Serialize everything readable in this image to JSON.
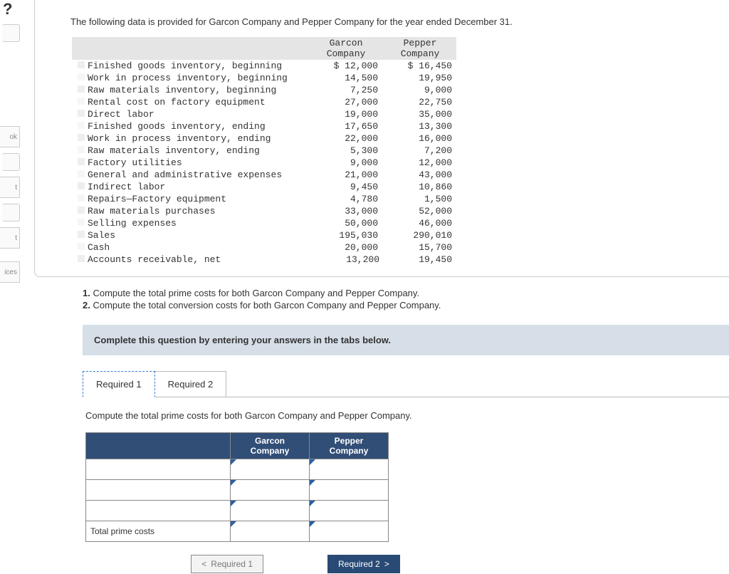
{
  "intro": "The following data is provided for Garcon Company and Pepper Company for the year ended December 31.",
  "table": {
    "headers": {
      "col1": "Garcon\nCompany",
      "col2": "Pepper\nCompany"
    },
    "rows": [
      {
        "label": "Finished goods inventory, beginning",
        "garcon": "$ 12,000",
        "pepper": "$ 16,450"
      },
      {
        "label": "Work in process inventory, beginning",
        "garcon": "14,500",
        "pepper": "19,950"
      },
      {
        "label": "Raw materials inventory, beginning",
        "garcon": "7,250",
        "pepper": "9,000"
      },
      {
        "label": "Rental cost on factory equipment",
        "garcon": "27,000",
        "pepper": "22,750"
      },
      {
        "label": "Direct labor",
        "garcon": "19,000",
        "pepper": "35,000"
      },
      {
        "label": "Finished goods inventory, ending",
        "garcon": "17,650",
        "pepper": "13,300"
      },
      {
        "label": "Work in process inventory, ending",
        "garcon": "22,000",
        "pepper": "16,000"
      },
      {
        "label": "Raw materials inventory, ending",
        "garcon": "5,300",
        "pepper": "7,200"
      },
      {
        "label": "Factory utilities",
        "garcon": "9,000",
        "pepper": "12,000"
      },
      {
        "label": "General and administrative expenses",
        "garcon": "21,000",
        "pepper": "43,000"
      },
      {
        "label": "Indirect labor",
        "garcon": "9,450",
        "pepper": "10,860"
      },
      {
        "label": "Repairs—Factory equipment",
        "garcon": "4,780",
        "pepper": "1,500"
      },
      {
        "label": "Raw materials purchases",
        "garcon": "33,000",
        "pepper": "52,000"
      },
      {
        "label": "Selling expenses",
        "garcon": "50,000",
        "pepper": "46,000"
      },
      {
        "label": "Sales",
        "garcon": "195,030",
        "pepper": "290,010"
      },
      {
        "label": "Cash",
        "garcon": "20,000",
        "pepper": "15,700"
      },
      {
        "label": "Accounts receivable, net",
        "garcon": "13,200",
        "pepper": "19,450"
      }
    ]
  },
  "questions": {
    "q1": "1. Compute the total prime costs for both Garcon Company and Pepper Company.",
    "q2": "2. Compute the total conversion costs for both Garcon Company and Pepper Company."
  },
  "instruction": "Complete this question by entering your answers in the tabs below.",
  "tabs": {
    "t1": "Required 1",
    "t2": "Required 2"
  },
  "tab1": {
    "prompt": "Compute the total prime costs for both Garcon Company and Pepper Company.",
    "col1": "Garcon\nCompany",
    "col2": "Pepper\nCompany",
    "total_label": "Total prime costs"
  },
  "nav": {
    "prev": "Required 1",
    "next": "Required 2"
  },
  "sidebar": {
    "s1": "ok",
    "s2": "t",
    "s3": "t",
    "s4": "ices"
  }
}
